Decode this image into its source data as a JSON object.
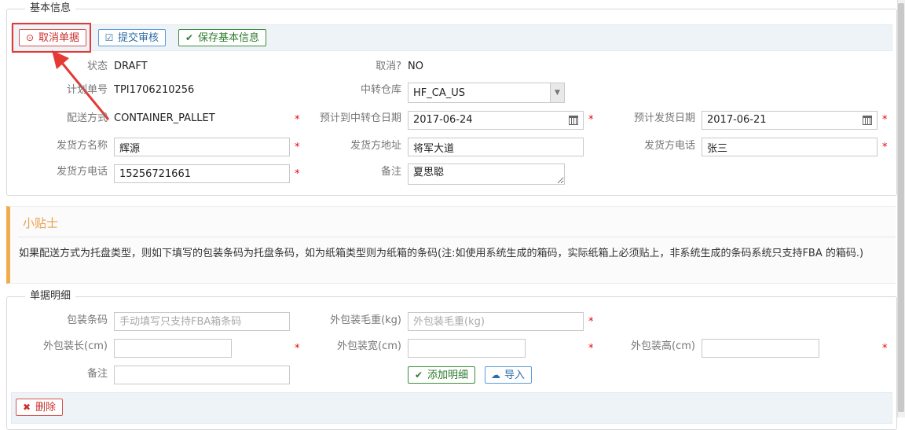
{
  "basic_info": {
    "legend": "基本信息",
    "toolbar": {
      "cancel_label": "取消单据",
      "submit_label": "提交审核",
      "save_label": "保存基本信息"
    },
    "status_label": "状态",
    "status_value": "DRAFT",
    "cancelled_label": "取消?",
    "cancelled_value": "NO",
    "plan_no_label": "计划单号",
    "plan_no_value": "TPI1706210256",
    "transit_warehouse_label": "中转仓库",
    "transit_warehouse_value": "HF_CA_US",
    "delivery_method_label": "配送方式",
    "delivery_method_value": "CONTAINER_PALLET",
    "eta_label": "预计到中转仓日期",
    "eta_value": "2017-06-24",
    "ship_date_label": "预计发货日期",
    "ship_date_value": "2017-06-21",
    "shipper_name_label": "发货方名称",
    "shipper_name_value": "辉源",
    "shipper_address_label": "发货方地址",
    "shipper_address_value": "将军大道",
    "shipper_phone_label": "发货方电话",
    "shipper_contact_value": "张三",
    "shipper_phone2_label": "发货方电话",
    "shipper_phone_value": "15256721661",
    "remark_label": "备注",
    "remark_value": "夏思聪"
  },
  "tips": {
    "title": "小贴士",
    "text": "如果配送方式为托盘类型，则如下填写的包装条码为托盘条码，如为纸箱类型则为纸箱的条码(注:如使用系统生成的箱码，实际纸箱上必须贴上，非系统生成的条码系统只支持FBA 的箱码.)"
  },
  "detail": {
    "legend": "单据明细",
    "barcode_label": "包装条码",
    "barcode_placeholder": "手动填写只支持FBA箱条码",
    "gross_weight_label": "外包装毛重(kg)",
    "gross_weight_placeholder": "外包装毛重(kg)",
    "length_label": "外包装长(cm)",
    "width_label": "外包装宽(cm)",
    "height_label": "外包装高(cm)",
    "remark_label": "备注",
    "add_label": "添加明细",
    "import_label": "导入",
    "delete_label": "删除"
  },
  "required_mark": "*",
  "colors": {
    "accent_red": "#e53935",
    "tips_accent": "#f0ad4e",
    "toolbar_bg": "#eef3f8"
  }
}
